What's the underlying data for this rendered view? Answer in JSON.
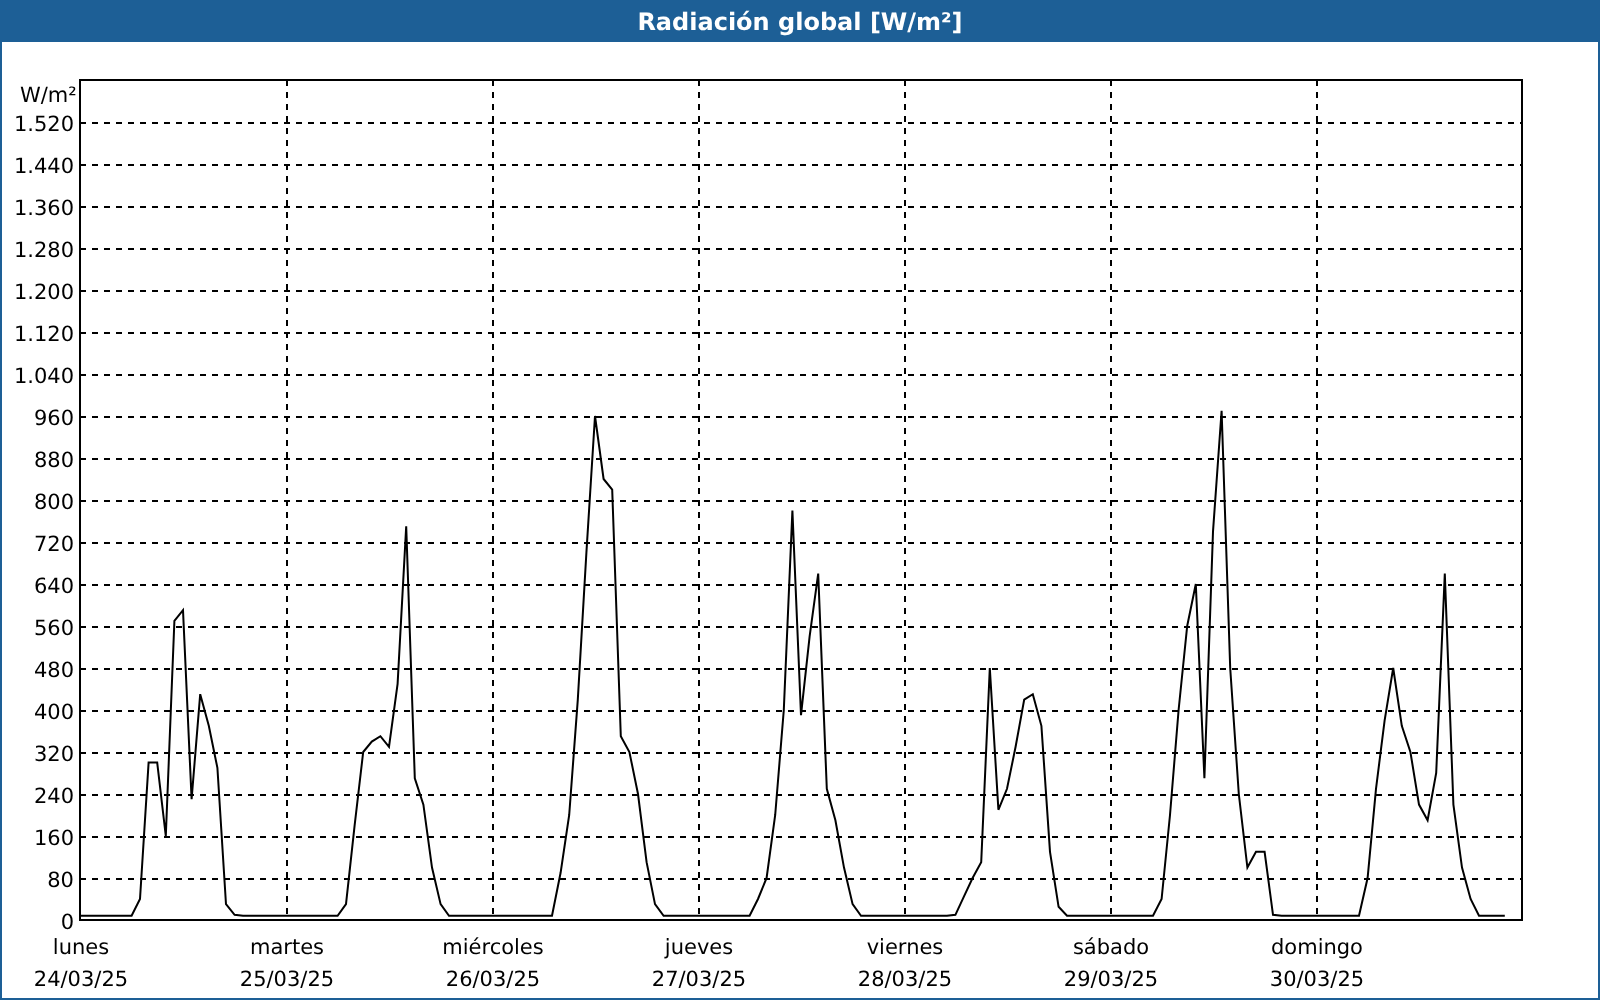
{
  "window": {
    "title": "Radiación global [W/m²]"
  },
  "chart": {
    "chart_data": {
      "type": "line",
      "ylabel": "W/m²",
      "grid": true,
      "ylim": [
        0,
        1600
      ],
      "categories": [
        "lunes 24/03/25",
        null,
        null,
        null,
        null,
        null,
        null,
        null,
        null,
        null,
        null,
        null,
        null,
        null,
        null,
        null,
        null,
        null,
        null,
        null,
        null,
        null,
        null,
        null,
        "martes 25/03/25",
        null,
        null,
        null,
        null,
        null,
        null,
        null,
        null,
        null,
        null,
        null,
        null,
        null,
        null,
        null,
        null,
        null,
        null,
        null,
        null,
        null,
        null,
        null,
        "miércoles 26/03/25",
        null,
        null,
        null,
        null,
        null,
        null,
        null,
        null,
        null,
        null,
        null,
        null,
        null,
        null,
        null,
        null,
        null,
        null,
        null,
        null,
        null,
        null,
        null,
        "jueves 27/03/25",
        null,
        null,
        null,
        null,
        null,
        null,
        null,
        null,
        null,
        null,
        null,
        null,
        null,
        null,
        null,
        null,
        null,
        null,
        null,
        null,
        null,
        null,
        null,
        "viernes 28/03/25",
        null,
        null,
        null,
        null,
        null,
        null,
        null,
        null,
        null,
        null,
        null,
        null,
        null,
        null,
        null,
        null,
        null,
        null,
        null,
        null,
        null,
        null,
        null,
        "sábado 29/03/25",
        null,
        null,
        null,
        null,
        null,
        null,
        null,
        null,
        null,
        null,
        null,
        null,
        null,
        null,
        null,
        null,
        null,
        null,
        null,
        null,
        null,
        null,
        null,
        "domingo 30/03/25",
        null,
        null,
        null,
        null,
        null,
        null,
        null,
        null,
        null,
        null,
        null,
        null,
        null,
        null,
        null,
        null,
        null,
        null,
        null,
        null,
        null,
        null
      ],
      "series": [
        {
          "color": "#000000",
          "values": [
            8,
            8,
            8,
            8,
            8,
            8,
            8,
            40,
            300,
            300,
            160,
            570,
            590,
            230,
            430,
            370,
            290,
            30,
            10,
            8,
            8,
            8,
            8,
            8,
            8,
            8,
            8,
            8,
            8,
            8,
            8,
            30,
            180,
            320,
            340,
            350,
            330,
            450,
            750,
            270,
            220,
            100,
            30,
            8,
            8,
            8,
            8,
            8,
            8,
            8,
            8,
            8,
            8,
            8,
            8,
            8,
            90,
            200,
            420,
            700,
            960,
            840,
            820,
            350,
            320,
            240,
            110,
            30,
            8,
            8,
            8,
            8,
            8,
            8,
            8,
            8,
            8,
            8,
            8,
            40,
            80,
            200,
            400,
            780,
            390,
            540,
            660,
            250,
            190,
            100,
            30,
            8,
            8,
            8,
            8,
            8,
            8,
            8,
            8,
            8,
            8,
            8,
            10,
            45,
            80,
            110,
            480,
            210,
            250,
            330,
            420,
            430,
            370,
            130,
            25,
            8,
            8,
            8,
            8,
            8,
            8,
            8,
            8,
            8,
            8,
            8,
            40,
            200,
            400,
            560,
            640,
            270,
            740,
            970,
            480,
            240,
            100,
            130,
            130,
            10,
            8,
            8,
            8,
            8,
            8,
            8,
            8,
            8,
            8,
            8,
            80,
            250,
            380,
            480,
            370,
            320,
            220,
            190,
            280,
            660,
            220,
            100,
            40,
            8,
            8,
            8,
            8
          ]
        }
      ],
      "yticks": [
        {
          "value": 0,
          "label": "0"
        },
        {
          "value": 80,
          "label": "80"
        },
        {
          "value": 160,
          "label": "160"
        },
        {
          "value": 240,
          "label": "240"
        },
        {
          "value": 320,
          "label": "320"
        },
        {
          "value": 400,
          "label": "400"
        },
        {
          "value": 480,
          "label": "480"
        },
        {
          "value": 560,
          "label": "560"
        },
        {
          "value": 640,
          "label": "640"
        },
        {
          "value": 720,
          "label": "720"
        },
        {
          "value": 800,
          "label": "800"
        },
        {
          "value": 880,
          "label": "880"
        },
        {
          "value": 960,
          "label": "960"
        },
        {
          "value": 1040,
          "label": "1.040"
        },
        {
          "value": 1120,
          "label": "1.120"
        },
        {
          "value": 1200,
          "label": "1.200"
        },
        {
          "value": 1280,
          "label": "1.280"
        },
        {
          "value": 1360,
          "label": "1.360"
        },
        {
          "value": 1440,
          "label": "1.440"
        },
        {
          "value": 1520,
          "label": "1.520"
        }
      ]
    }
  }
}
